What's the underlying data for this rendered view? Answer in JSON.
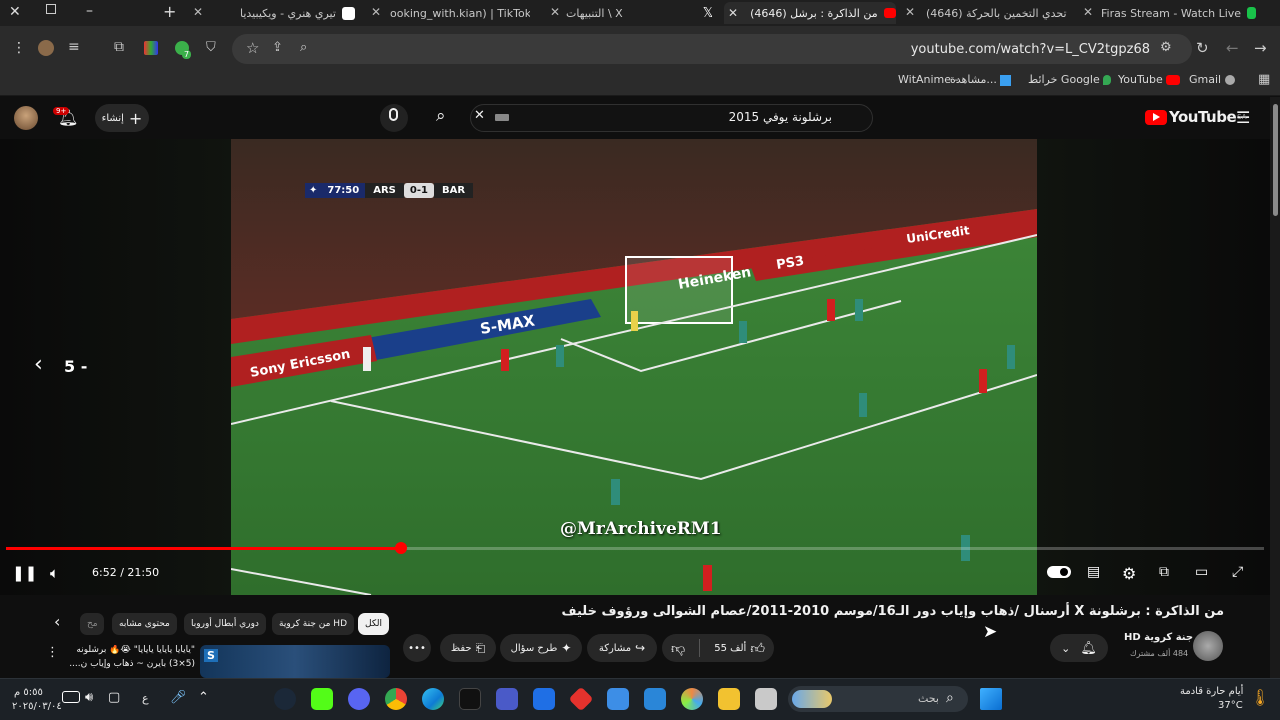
{
  "browser": {
    "tabs": [
      {
        "title": "Firas Stream - Watch Live",
        "active": false
      },
      {
        "title": "(4646) تحدي التخمين بالحركة",
        "active": false
      },
      {
        "title": "(4646) من الذاكرة : برشل",
        "active": true
      },
      {
        "title": "التنبيهات \\ X",
        "active": false
      },
      {
        "title": "ooking_with.kian) | TikTok",
        "active": false
      },
      {
        "title": "تيري هنري - ويكيبيديا",
        "active": false
      }
    ],
    "url": "youtube.com/watch?v=L_CV2tgpz68",
    "extension_badge": "7",
    "bookmarks": [
      "Gmail",
      "YouTube",
      "خرائط Google",
      "مشاهدة...",
      "WitAnime -"
    ]
  },
  "youtube": {
    "logo_text": "YouTube",
    "region": "SA",
    "search_query": "برشلونة يوفي 2015",
    "create_label": "إنشاء",
    "notification_count": "9+"
  },
  "video": {
    "scoreboard": {
      "clock": "77:50",
      "home": "ARS",
      "score": "0-1",
      "away": "BAR"
    },
    "watermark": "@MrArchiveRM1",
    "board_texts": [
      "S-MAX",
      "Sony Ericsson",
      "Heineken",
      "PS3",
      "UniCredit"
    ],
    "time_display": "6:52 / 21:50",
    "progress_fraction": 0.314,
    "seek_hint": "5 -"
  },
  "details": {
    "title": "من الذاكرة : برشلونة X أرسنال /ذهاب وإياب دور الـ16/موسم 2010-2011/عصام الشوالى ورؤوف خليف",
    "channel_name": "جنة كروية HD",
    "subscribers": "484 ألف مشترك",
    "likes": "55 ألف",
    "share_label": "مشاركة",
    "ask_label": "طرح سؤال",
    "save_label": "حفظ",
    "chips": [
      "الكل",
      "من جنة كروية HD",
      "دوري أبطال أوروبا",
      "محتوى مشابه",
      "مح"
    ],
    "recommendation_line1": "\"يايايا يايايا يايايا\" 😭🔥 برشلونه",
    "recommendation_line2": "(5×3) بايرن ~ ذهاب وإياب ن...."
  },
  "taskbar": {
    "weather_label": "أيام حارة قادمة",
    "temperature": "37°C",
    "search_placeholder": "بحث",
    "time": "٥:٥٥ م",
    "date": "٢٠٢٥/٠٣/٠٤",
    "language": "ع"
  }
}
